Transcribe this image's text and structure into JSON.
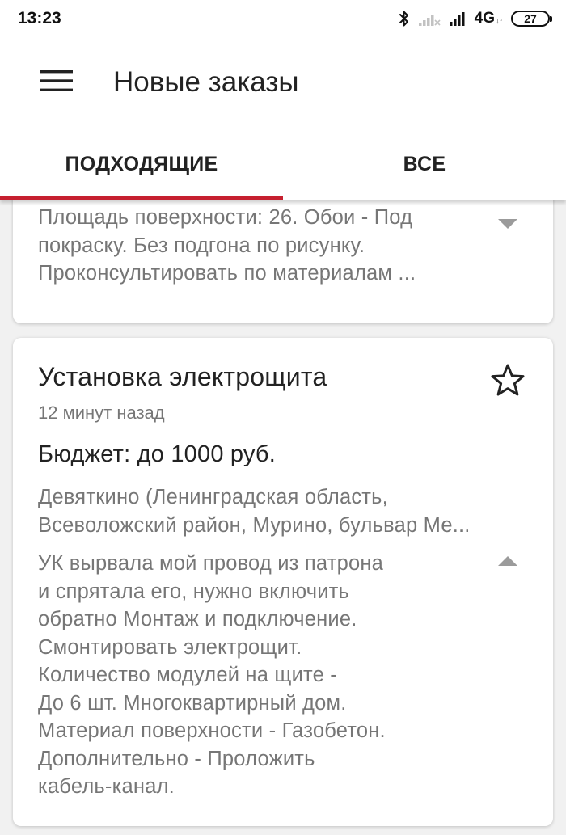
{
  "status_bar": {
    "time": "13:23",
    "network": "4G",
    "network_sub": "↓↑",
    "battery": "27"
  },
  "header": {
    "title": "Новые заказы"
  },
  "tabs": [
    {
      "label": "ПОДХОДЯЩИЕ",
      "active": true
    },
    {
      "label": "ВСЕ",
      "active": false
    }
  ],
  "colors": {
    "accent": "#c6202f",
    "secondary_text": "#767676",
    "primary_text": "#222222"
  },
  "orders": [
    {
      "description_lines": [
        "Площадь поверхности: 26. Обои - Под",
        "покраску. Без подгона по рисунку.",
        "Проконсультировать по материалам ..."
      ],
      "expanded": false
    },
    {
      "title": "Установка электрощита",
      "time_ago": "12 минут назад",
      "budget": "Бюджет: до 1000 руб.",
      "address_lines": [
        "Девяткино (Ленинградская область,",
        "Всеволожский район, Мурино, бульвар Ме..."
      ],
      "description_lines": [
        "УК вырвала мой провод из патрона",
        "и спрятала его, нужно включить",
        "обратно Монтаж и подключение.",
        "Смонтировать электрощит.",
        "Количество модулей на щите -",
        "До 6 шт. Многоквартирный дом.",
        "Материал поверхности - Газобетон.",
        "Дополнительно - Проложить",
        "кабель-канал."
      ],
      "expanded": true
    }
  ]
}
